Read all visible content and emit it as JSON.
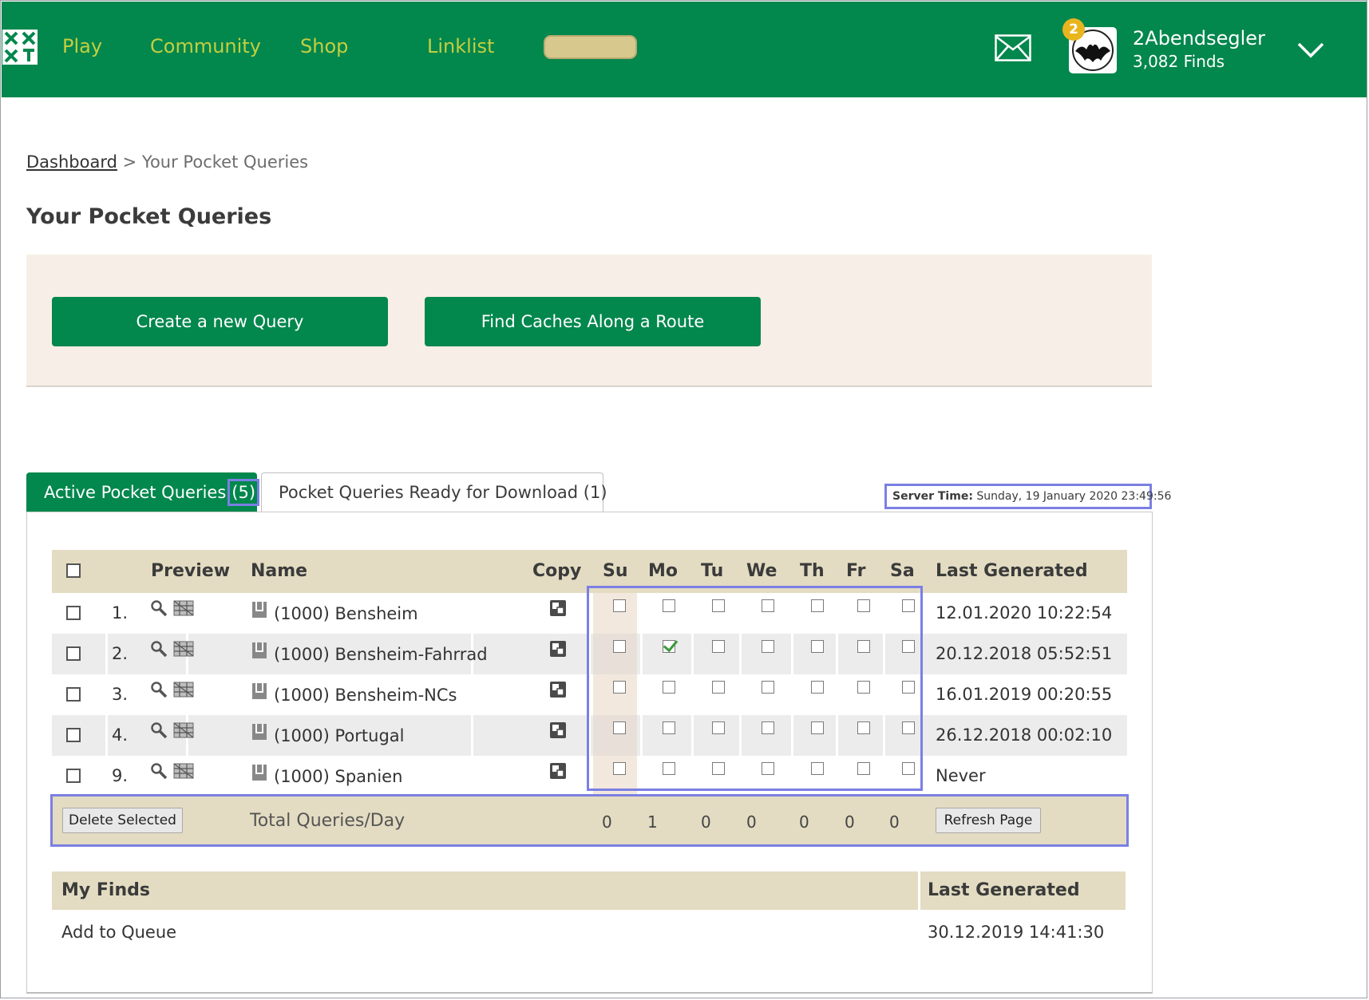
{
  "nav": {
    "items": [
      "Play",
      "Community",
      "Shop",
      "Linklist"
    ],
    "colors": {
      "header_bg": "#02874d",
      "nav_text": "#c4cf3f",
      "search_pill": "#d7c88e"
    }
  },
  "user": {
    "name": "2Abendsegler",
    "finds": "3,082 Finds",
    "notifications": "2"
  },
  "breadcrumb": {
    "root": "Dashboard",
    "separator": ">",
    "current": "Your Pocket Queries"
  },
  "page": {
    "title": "Your Pocket Queries"
  },
  "actions": {
    "create": "Create a new Query",
    "route": "Find Caches Along a Route"
  },
  "tabs": {
    "active": {
      "label": "Active Pocket Queries",
      "count": "(5)"
    },
    "ready": {
      "label": "Pocket Queries Ready for Download (1)"
    }
  },
  "server_time": {
    "label": "Server Time:",
    "value": "Sunday, 19 January 2020 23:49:56"
  },
  "table": {
    "headers": {
      "preview": "Preview",
      "name": "Name",
      "copy": "Copy",
      "last": "Last Generated"
    },
    "days": [
      "Su",
      "Mo",
      "Tu",
      "We",
      "Th",
      "Fr",
      "Sa"
    ],
    "rows": [
      {
        "num": "1.",
        "name": "(1000) Bensheim",
        "days": [
          false,
          false,
          false,
          false,
          false,
          false,
          false
        ],
        "last": "12.01.2020 10:22:54"
      },
      {
        "num": "2.",
        "name": "(1000) Bensheim-Fahrrad",
        "days": [
          false,
          true,
          false,
          false,
          false,
          false,
          false
        ],
        "last": "20.12.2018 05:52:51"
      },
      {
        "num": "3.",
        "name": "(1000) Bensheim-NCs",
        "days": [
          false,
          false,
          false,
          false,
          false,
          false,
          false
        ],
        "last": "16.01.2019 00:20:55"
      },
      {
        "num": "4.",
        "name": "(1000) Portugal",
        "days": [
          false,
          false,
          false,
          false,
          false,
          false,
          false
        ],
        "last": "26.12.2018 00:02:10"
      },
      {
        "num": "9.",
        "name": "(1000) Spanien",
        "days": [
          false,
          false,
          false,
          false,
          false,
          false,
          false
        ],
        "last": "Never"
      }
    ],
    "footer": {
      "delete": "Delete Selected",
      "total_label": "Total Queries/Day",
      "totals": [
        "0",
        "1",
        "0",
        "0",
        "0",
        "0",
        "0"
      ],
      "refresh": "Refresh Page"
    }
  },
  "my_finds": {
    "header": "My Finds",
    "last_header": "Last Generated",
    "action": "Add to Queue",
    "last": "30.12.2019 14:41:30"
  }
}
